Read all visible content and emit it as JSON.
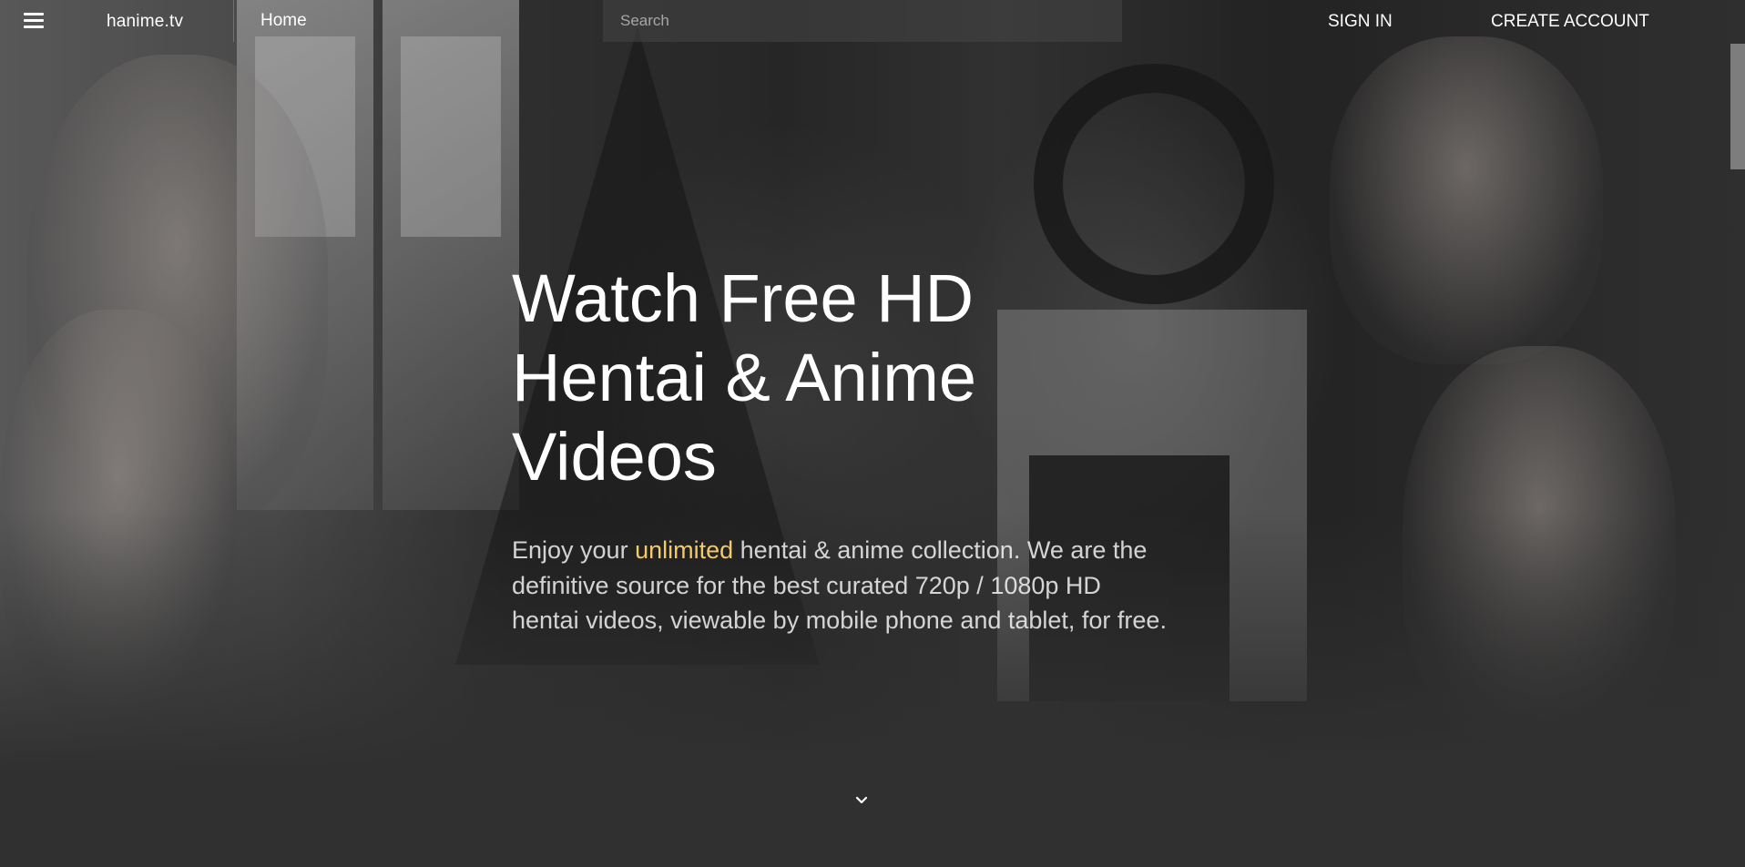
{
  "header": {
    "menu_icon": "hamburger-menu-icon",
    "brand": "hanime.tv",
    "nav_home": "Home",
    "search_placeholder": "Search",
    "search_value": "",
    "sign_in": "SIGN IN",
    "create_account": "CREATE ACCOUNT"
  },
  "hero": {
    "title_line1": "Watch Free HD",
    "title_line2": "Hentai & Anime",
    "title_line3": "Videos",
    "desc_prefix": "Enjoy your ",
    "desc_highlight": "unlimited",
    "desc_suffix_line1": " hentai & anime collection. We are the",
    "desc_line2": "definitive source for the best curated 720p / 1080p HD",
    "desc_line3": "hentai videos, viewable by mobile phone and tablet, for free.",
    "scroll_icon": "chevron-down-icon"
  },
  "colors": {
    "background": "#303030",
    "highlight": "#f3c969",
    "text": "#ffffff"
  }
}
